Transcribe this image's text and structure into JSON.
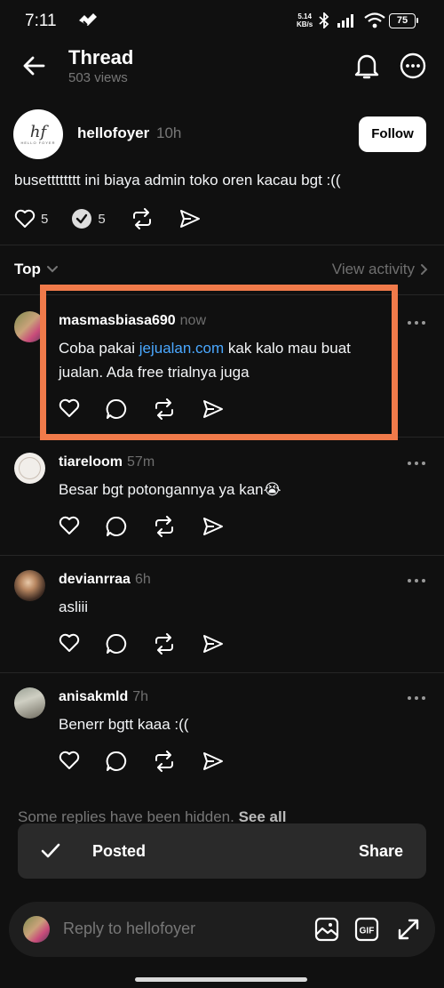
{
  "status": {
    "time": "7:11",
    "net_speed_value": "5.14",
    "net_speed_unit": "KB/s",
    "battery": "75"
  },
  "header": {
    "title": "Thread",
    "views": "503 views",
    "icons": [
      "back-arrow-icon",
      "bell-icon",
      "more-circle-icon"
    ]
  },
  "op": {
    "avatar_mono": "hf",
    "avatar_sub": "HELLO FOYER",
    "username": "hellofoyer",
    "time": "10h",
    "follow_label": "Follow",
    "text": "busetttttttt ini biaya admin toko oren kacau bgt :((",
    "likes": "5",
    "reposts": "5"
  },
  "sort": {
    "label": "Top",
    "view_activity": "View activity"
  },
  "replies": [
    {
      "username": "masmasbiasa690",
      "time": "now",
      "text_before": "Coba pakai ",
      "link": "jejualan.com",
      "text_after": " kak kalo mau buat jualan. Ada free trialnya juga"
    },
    {
      "username": "tiareloom",
      "time": "57m",
      "text": "Besar bgt potongannya ya kan😭"
    },
    {
      "username": "devianrraa",
      "time": "6h",
      "text": "asliii"
    },
    {
      "username": "anisakmld",
      "time": "7h",
      "text": "Benerr bgtt kaaa :(("
    }
  ],
  "hidden": {
    "text": "Some replies have been hidden. ",
    "see_all": "See all"
  },
  "toast": {
    "posted": "Posted",
    "share": "Share"
  },
  "composer": {
    "placeholder": "Reply to hellofoyer",
    "gif": "GIF"
  },
  "colors": {
    "background": "#101010",
    "link": "#4aa8ff",
    "highlight": "#f07a4a"
  }
}
